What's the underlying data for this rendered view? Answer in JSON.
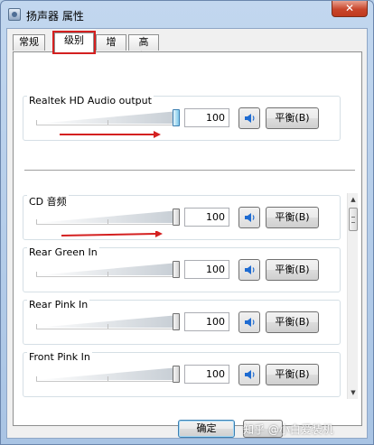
{
  "window": {
    "title": "扬声器 属性",
    "close_glyph": "✕"
  },
  "tabs": [
    {
      "label": "常规",
      "active": false
    },
    {
      "label": "级别",
      "active": true
    },
    {
      "label": "增强",
      "active": false
    },
    {
      "label": "高级",
      "active": false
    }
  ],
  "controls": [
    {
      "label": "Realtek HD Audio output",
      "value": "100",
      "balance_label": "平衡(B)"
    },
    {
      "label": "CD 音频",
      "value": "100",
      "balance_label": "平衡(B)"
    },
    {
      "label": "Rear Green In",
      "value": "100",
      "balance_label": "平衡(B)"
    },
    {
      "label": "Rear Pink In",
      "value": "100",
      "balance_label": "平衡(B)"
    },
    {
      "label": "Front Pink In",
      "value": "100",
      "balance_label": "平衡(B)"
    }
  ],
  "slider_level": 1.0,
  "footer": {
    "ok_label": "确定"
  },
  "watermark": "知乎 @小白爱装机",
  "colors": {
    "annotation_red": "#d42020",
    "accent_blue": "#1e6bd1"
  },
  "icons": {
    "mute": "speaker-icon",
    "scroll_up": "arrow-up-icon",
    "scroll_down": "arrow-down-icon"
  }
}
